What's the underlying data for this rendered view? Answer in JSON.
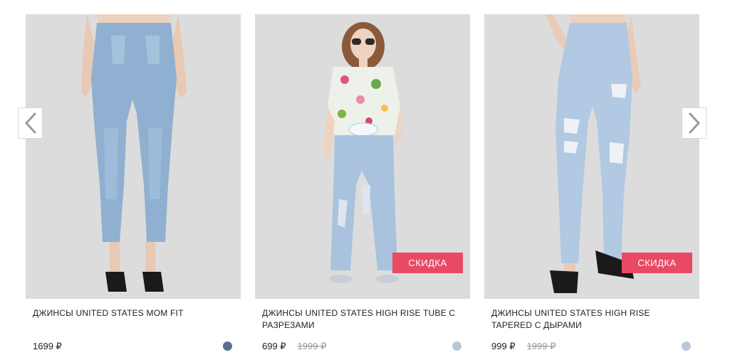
{
  "products": [
    {
      "title": "ДЖИНСЫ UNITED STATES MOM FIT",
      "price": "1699 ₽",
      "old_price": "",
      "badge": "",
      "swatch_color": "#5a6f8f",
      "photo_icon": "jeans-photo"
    },
    {
      "title": "ДЖИНСЫ UNITED STATES HIGH RISE TUBE С РАЗРЕЗАМИ",
      "price": "699 ₽",
      "old_price": "1999 ₽",
      "badge": "СКИДКА",
      "swatch_color": "#b9c7d8",
      "photo_icon": "model-photo"
    },
    {
      "title": "ДЖИНСЫ UNITED STATES HIGH RISE TAPERED С ДЫРАМИ",
      "price": "999 ₽",
      "old_price": "1999 ₽",
      "badge": "СКИДКА",
      "swatch_color": "#b9c7d8",
      "photo_icon": "jeans-photo"
    }
  ],
  "navigation": {
    "prev_icon": "chevron-left-icon",
    "next_icon": "chevron-right-icon"
  },
  "colors": {
    "badge": "#e84a64",
    "photo_bg": "#dcdcdc"
  }
}
